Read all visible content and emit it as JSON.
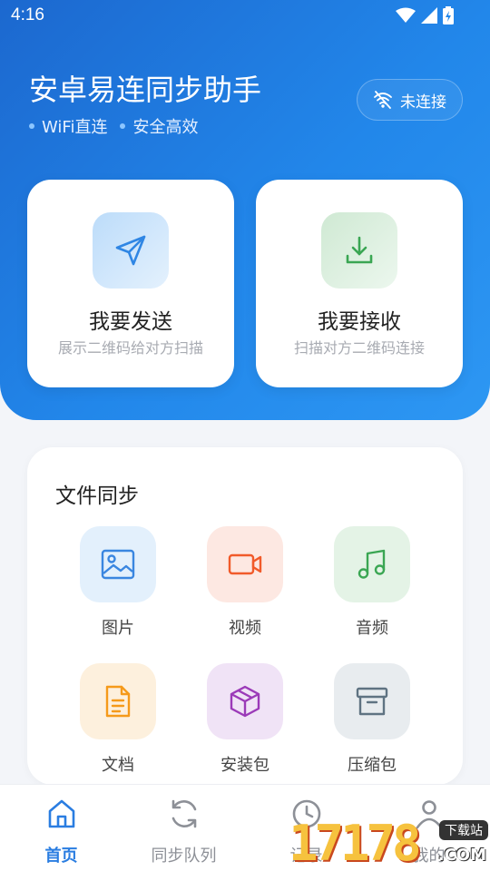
{
  "status": {
    "time": "4:16"
  },
  "header": {
    "title": "安卓易连同步助手",
    "tags": [
      "WiFi直连",
      "安全高效"
    ],
    "connection_label": "未连接"
  },
  "actions": [
    {
      "title": "我要发送",
      "subtitle": "展示二维码给对方扫描",
      "icon": "send-icon"
    },
    {
      "title": "我要接收",
      "subtitle": "扫描对方二维码连接",
      "icon": "download-icon"
    }
  ],
  "file_sync": {
    "title": "文件同步",
    "items": [
      {
        "label": "图片",
        "icon": "image-icon",
        "color": "#3a86e0",
        "bg": "#e3f0fc"
      },
      {
        "label": "视频",
        "icon": "video-icon",
        "color": "#f15a2a",
        "bg": "#fde8e2"
      },
      {
        "label": "音频",
        "icon": "music-icon",
        "color": "#3aa653",
        "bg": "#e4f3e6"
      },
      {
        "label": "文档",
        "icon": "document-icon",
        "color": "#f59a1a",
        "bg": "#fdf0dd"
      },
      {
        "label": "安装包",
        "icon": "package-icon",
        "color": "#9b3ab8",
        "bg": "#f0e3f6"
      },
      {
        "label": "压缩包",
        "icon": "archive-icon",
        "color": "#5f7382",
        "bg": "#e8ecef"
      }
    ]
  },
  "tabbar": {
    "items": [
      {
        "label": "首页",
        "icon": "home-icon",
        "active": true
      },
      {
        "label": "同步队列",
        "icon": "sync-icon",
        "active": false
      },
      {
        "label": "记录",
        "icon": "clock-icon",
        "active": false
      },
      {
        "label": "我的",
        "icon": "user-icon",
        "active": false
      }
    ]
  },
  "watermark": {
    "digits": "17178",
    "badge": "下载站",
    "suffix": ".COM"
  },
  "colors": {
    "primary": "#2287ea",
    "active_tab": "#2a7de1"
  }
}
